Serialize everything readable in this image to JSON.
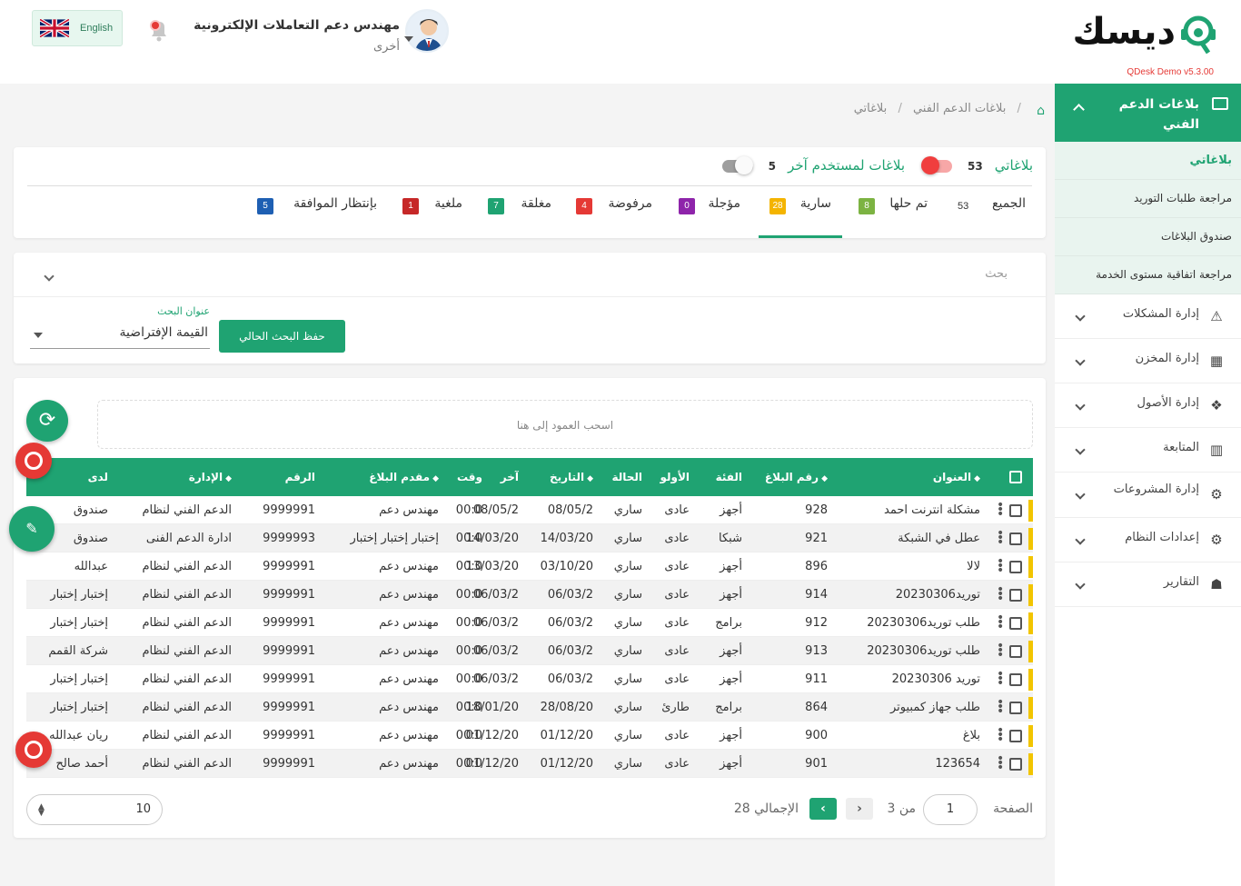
{
  "header": {
    "logo_text": "ديسك",
    "logo_version": "QDesk Demo v5.3.00",
    "user_name": "مهندس دعم التعاملات الإلكترونية",
    "user_role": "أخرى",
    "lang_label": "English"
  },
  "sidebar": {
    "section_title": "بلاغات الدعم الفني",
    "sub_items": [
      {
        "label": "بلاغاتي"
      },
      {
        "label": "مراجعة طلبات التوريد"
      },
      {
        "label": "صندوق البلاغات"
      },
      {
        "label": "مراجعة اتفاقية مستوى الخدمة"
      }
    ],
    "items": [
      {
        "label": "إدارة المشكلات",
        "icon": "warning-icon"
      },
      {
        "label": "إدارة المخزن",
        "icon": "boxes-icon"
      },
      {
        "label": "إدارة الأصول",
        "icon": "cubes-icon"
      },
      {
        "label": "المتابعة",
        "icon": "chart-icon"
      },
      {
        "label": "إدارة المشروعات",
        "icon": "users-gear-icon"
      },
      {
        "label": "إعدادات النظام",
        "icon": "gears-icon"
      },
      {
        "label": "التقارير",
        "icon": "user-report-icon"
      }
    ]
  },
  "breadcrumb": {
    "level1": "بلاغات الدعم الفني",
    "level2": "بلاغاتي"
  },
  "switches": {
    "mine_label": "بلاغاتي",
    "mine_count": "53",
    "other_label": "بلاغات لمستخدم آخر",
    "other_count": "5"
  },
  "tabs": [
    {
      "label": "الجميع",
      "count": "53",
      "color": ""
    },
    {
      "label": "تم حلها",
      "count": "8",
      "color": "#7cb342"
    },
    {
      "label": "سارية",
      "count": "28",
      "color": "#f4b400"
    },
    {
      "label": "مؤجلة",
      "count": "0",
      "color": "#8e24aa"
    },
    {
      "label": "مرفوضة",
      "count": "4",
      "color": "#e53935"
    },
    {
      "label": "مغلقة",
      "count": "7",
      "color": "#1fa372"
    },
    {
      "label": "ملغية",
      "count": "1",
      "color": "#c62828"
    },
    {
      "label": "بإنتظار الموافقة",
      "count": "5",
      "color": "#1e5fb3"
    }
  ],
  "search": {
    "title": "بحث",
    "saved_label": "عنوان البحث",
    "saved_value": "القيمة الإفتراضية",
    "save_button": "حفظ البحث الحالي"
  },
  "table": {
    "group_zone": "اسحب العمود إلى هنا",
    "columns": {
      "title": "العنوان",
      "number": "رقم البلاغ",
      "category": "الفئة",
      "priority": "الأولو",
      "status": "الحالة",
      "date": "التاريخ",
      "last": "آخر",
      "time": "وقت",
      "submitter": "مقدم البلاغ",
      "ref": "الرقم",
      "dept": "الإدارة",
      "holder": "لدى"
    },
    "rows": [
      {
        "title": "مشكلة انترنت احمد",
        "number": "928",
        "category": "أجهز",
        "priority": "عادى",
        "status": "ساري",
        "date": "08/05/2",
        "last": "08/05/2",
        "time": "00:0",
        "submitter": "مهندس دعم",
        "ref": "9999991",
        "dept": "الدعم الفني لنظام",
        "holder": "صندوق"
      },
      {
        "title": "عطل في الشبكة",
        "number": "921",
        "category": "شبكا",
        "priority": "عادى",
        "status": "ساري",
        "date": "14/03/20",
        "last": "14/03/20",
        "time": "00:0",
        "submitter": "إختبار إختبار إختبار",
        "ref": "9999993",
        "dept": "ادارة الدعم الفنى",
        "holder": "صندوق"
      },
      {
        "title": "لالا",
        "number": "896",
        "category": "أجهز",
        "priority": "عادى",
        "status": "ساري",
        "date": "03/10/20",
        "last": "13/03/20",
        "time": "00:0",
        "submitter": "مهندس دعم",
        "ref": "9999991",
        "dept": "الدعم الفني لنظام",
        "holder": "عبدالله"
      },
      {
        "title": "توريد20230306",
        "number": "914",
        "category": "أجهز",
        "priority": "عادى",
        "status": "ساري",
        "date": "06/03/2",
        "last": "06/03/2",
        "time": "00:0",
        "submitter": "مهندس دعم",
        "ref": "9999991",
        "dept": "الدعم الفني لنظام",
        "holder": "إختبار إختبار"
      },
      {
        "title": "طلب توريد20230306",
        "number": "912",
        "category": "برامج",
        "priority": "عادى",
        "status": "ساري",
        "date": "06/03/2",
        "last": "06/03/2",
        "time": "00:0",
        "submitter": "مهندس دعم",
        "ref": "9999991",
        "dept": "الدعم الفني لنظام",
        "holder": "إختبار إختبار"
      },
      {
        "title": "طلب توريد20230306",
        "number": "913",
        "category": "أجهز",
        "priority": "عادى",
        "status": "ساري",
        "date": "06/03/2",
        "last": "06/03/2",
        "time": "00:0",
        "submitter": "مهندس دعم",
        "ref": "9999991",
        "dept": "الدعم الفني لنظام",
        "holder": "شركة القمم"
      },
      {
        "title": "توريد 20230306",
        "number": "911",
        "category": "أجهز",
        "priority": "عادى",
        "status": "ساري",
        "date": "06/03/2",
        "last": "06/03/2",
        "time": "00:0",
        "submitter": "مهندس دعم",
        "ref": "9999991",
        "dept": "الدعم الفني لنظام",
        "holder": "إختبار إختبار"
      },
      {
        "title": "طلب جهاز كمبيوتر",
        "number": "864",
        "category": "برامج",
        "priority": "طارئ",
        "status": "ساري",
        "date": "28/08/20",
        "last": "18/01/20",
        "time": "00:0",
        "submitter": "مهندس دعم",
        "ref": "9999991",
        "dept": "الدعم الفني لنظام",
        "holder": "إختبار إختبار"
      },
      {
        "title": "بلاغ",
        "number": "900",
        "category": "أجهز",
        "priority": "عادى",
        "status": "ساري",
        "date": "01/12/20",
        "last": "01/12/20",
        "time": "00:0",
        "submitter": "مهندس دعم",
        "ref": "9999991",
        "dept": "الدعم الفني لنظام",
        "holder": "ريان عبدالله"
      },
      {
        "title": "123654",
        "number": "901",
        "category": "أجهز",
        "priority": "عادى",
        "status": "ساري",
        "date": "01/12/20",
        "last": "01/12/20",
        "time": "00:0",
        "submitter": "مهندس دعم",
        "ref": "9999991",
        "dept": "الدعم الفني لنظام",
        "holder": "أحمد صالح"
      }
    ]
  },
  "pager": {
    "page_label": "الصفحة",
    "page_value": "1",
    "of_label": "من 3",
    "total_label": "الإجمالي 28",
    "page_size": "10"
  },
  "colors": {
    "brand": "#1fa372",
    "alert": "#e53935",
    "priority_bar": "#f2c500"
  }
}
